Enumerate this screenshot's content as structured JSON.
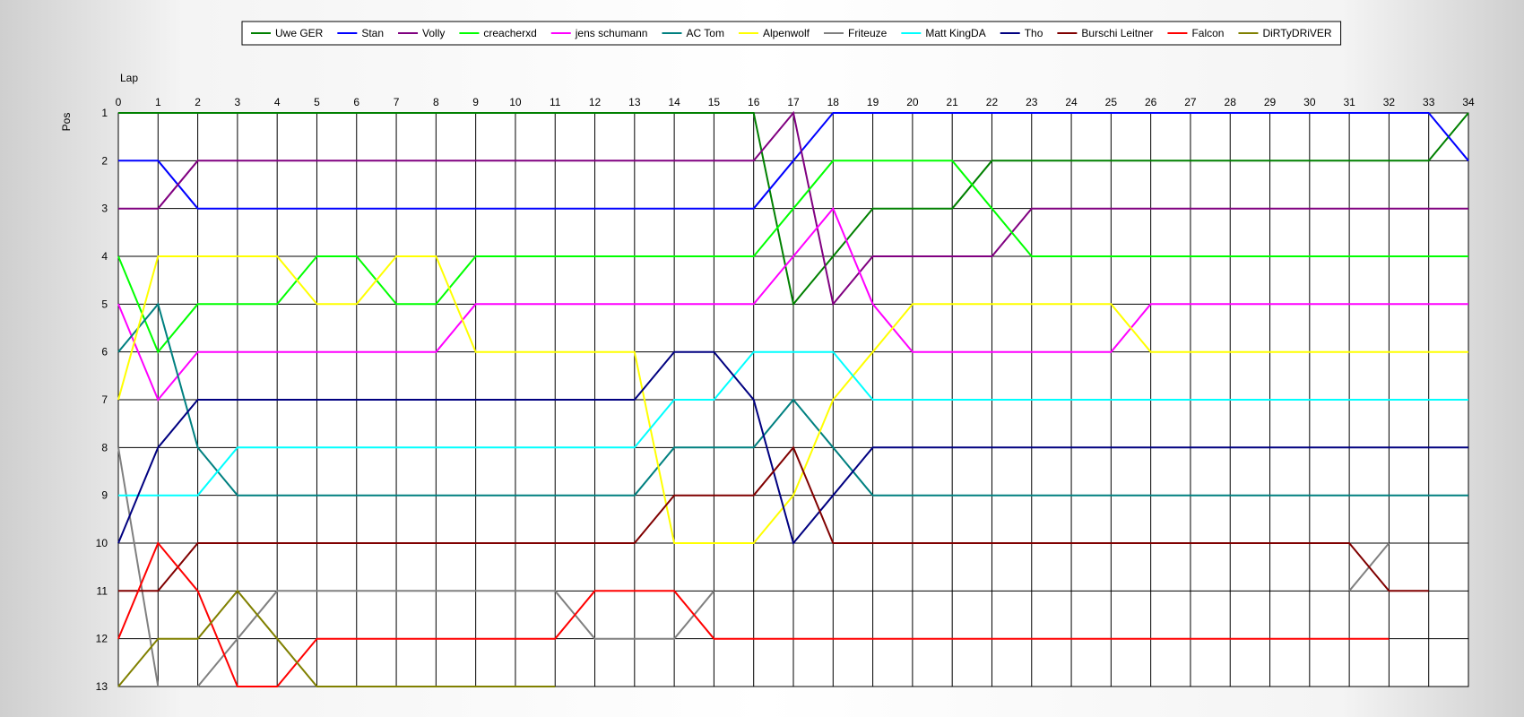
{
  "chart_data": {
    "type": "line",
    "title": "",
    "xlabel": "Lap",
    "ylabel": "Pos",
    "x": [
      0,
      1,
      2,
      3,
      4,
      5,
      6,
      7,
      8,
      9,
      10,
      11,
      12,
      13,
      14,
      15,
      16,
      17,
      18,
      19,
      20,
      21,
      22,
      23,
      24,
      25,
      26,
      27,
      28,
      29,
      30,
      31,
      32,
      33,
      34
    ],
    "xlim": [
      0,
      34
    ],
    "ylim": [
      1,
      13
    ],
    "y_inverted": true,
    "x_axis_position": "top",
    "grid": true,
    "legend_position": "top-center",
    "series": [
      {
        "name": "Uwe GER",
        "color": "#008000",
        "values": [
          1,
          1,
          1,
          1,
          1,
          1,
          1,
          1,
          1,
          1,
          1,
          1,
          1,
          1,
          1,
          1,
          1,
          5,
          4,
          3,
          3,
          3,
          2,
          2,
          2,
          2,
          2,
          2,
          2,
          2,
          2,
          2,
          2,
          2,
          1
        ]
      },
      {
        "name": "Stan",
        "color": "#0000ff",
        "values": [
          2,
          2,
          3,
          3,
          3,
          3,
          3,
          3,
          3,
          3,
          3,
          3,
          3,
          3,
          3,
          3,
          3,
          2,
          1,
          1,
          1,
          1,
          1,
          1,
          1,
          1,
          1,
          1,
          1,
          1,
          1,
          1,
          1,
          1,
          2
        ]
      },
      {
        "name": "Volly",
        "color": "#800080",
        "values": [
          3,
          3,
          2,
          2,
          2,
          2,
          2,
          2,
          2,
          2,
          2,
          2,
          2,
          2,
          2,
          2,
          2,
          1,
          5,
          4,
          4,
          4,
          4,
          3,
          3,
          3,
          3,
          3,
          3,
          3,
          3,
          3,
          3,
          3,
          3
        ]
      },
      {
        "name": "creacherxd",
        "color": "#00ff00",
        "values": [
          4,
          6,
          5,
          5,
          5,
          4,
          4,
          5,
          5,
          4,
          4,
          4,
          4,
          4,
          4,
          4,
          4,
          3,
          2,
          2,
          2,
          2,
          3,
          4,
          4,
          4,
          4,
          4,
          4,
          4,
          4,
          4,
          4,
          4,
          4
        ]
      },
      {
        "name": "jens  schumann",
        "color": "#ff00ff",
        "values": [
          5,
          7,
          6,
          6,
          6,
          6,
          6,
          6,
          6,
          5,
          5,
          5,
          5,
          5,
          5,
          5,
          5,
          4,
          3,
          5,
          6,
          6,
          6,
          6,
          6,
          6,
          5,
          5,
          5,
          5,
          5,
          5,
          5,
          5,
          5
        ]
      },
      {
        "name": "AC Tom",
        "color": "#008080",
        "values": [
          6,
          5,
          8,
          9,
          9,
          9,
          9,
          9,
          9,
          9,
          9,
          9,
          9,
          9,
          8,
          8,
          8,
          7,
          8,
          9,
          9,
          9,
          9,
          9,
          9,
          9,
          9,
          9,
          9,
          9,
          9,
          9,
          9,
          9,
          9
        ]
      },
      {
        "name": "Alpenwolf",
        "color": "#ffff00",
        "values": [
          7,
          4,
          4,
          4,
          4,
          5,
          5,
          4,
          4,
          6,
          6,
          6,
          6,
          6,
          10,
          10,
          10,
          9,
          7,
          6,
          5,
          5,
          5,
          5,
          5,
          5,
          6,
          6,
          6,
          6,
          6,
          6,
          6,
          6,
          6
        ]
      },
      {
        "name": "Friteuze",
        "color": "#808080",
        "values": [
          8,
          13,
          13,
          12,
          11,
          11,
          11,
          11,
          11,
          11,
          11,
          11,
          12,
          12,
          12,
          11,
          null,
          null,
          null,
          null,
          null,
          null,
          null,
          null,
          null,
          null,
          null,
          null,
          null,
          null,
          null,
          11,
          10,
          null,
          null
        ]
      },
      {
        "name": "Matt KingDA",
        "color": "#00ffff",
        "values": [
          9,
          9,
          9,
          8,
          8,
          8,
          8,
          8,
          8,
          8,
          8,
          8,
          8,
          8,
          7,
          7,
          6,
          6,
          6,
          7,
          7,
          7,
          7,
          7,
          7,
          7,
          7,
          7,
          7,
          7,
          7,
          7,
          7,
          7,
          7
        ]
      },
      {
        "name": "Tho",
        "color": "#000080",
        "values": [
          10,
          8,
          7,
          7,
          7,
          7,
          7,
          7,
          7,
          7,
          7,
          7,
          7,
          7,
          6,
          6,
          7,
          10,
          9,
          8,
          8,
          8,
          8,
          8,
          8,
          8,
          8,
          8,
          8,
          8,
          8,
          8,
          8,
          8,
          8
        ]
      },
      {
        "name": "Burschi Leitner",
        "color": "#800000",
        "values": [
          11,
          11,
          10,
          10,
          10,
          10,
          10,
          10,
          10,
          10,
          10,
          10,
          10,
          10,
          9,
          9,
          9,
          8,
          10,
          10,
          10,
          10,
          10,
          10,
          10,
          10,
          10,
          10,
          10,
          10,
          10,
          10,
          11,
          11,
          null
        ]
      },
      {
        "name": "Falcon",
        "color": "#ff0000",
        "values": [
          12,
          10,
          11,
          13,
          13,
          12,
          12,
          12,
          12,
          12,
          12,
          12,
          11,
          11,
          11,
          12,
          12,
          12,
          12,
          12,
          12,
          12,
          12,
          12,
          12,
          12,
          12,
          12,
          12,
          12,
          12,
          12,
          12,
          null,
          null
        ]
      },
      {
        "name": "DiRTyDRiVER",
        "color": "#808000",
        "values": [
          13,
          12,
          12,
          11,
          12,
          13,
          13,
          13,
          13,
          13,
          13,
          13,
          null,
          null,
          null,
          null,
          null,
          null,
          null,
          null,
          null,
          null,
          null,
          null,
          null,
          null,
          null,
          null,
          null,
          null,
          null,
          null,
          null,
          null,
          null
        ]
      }
    ]
  }
}
